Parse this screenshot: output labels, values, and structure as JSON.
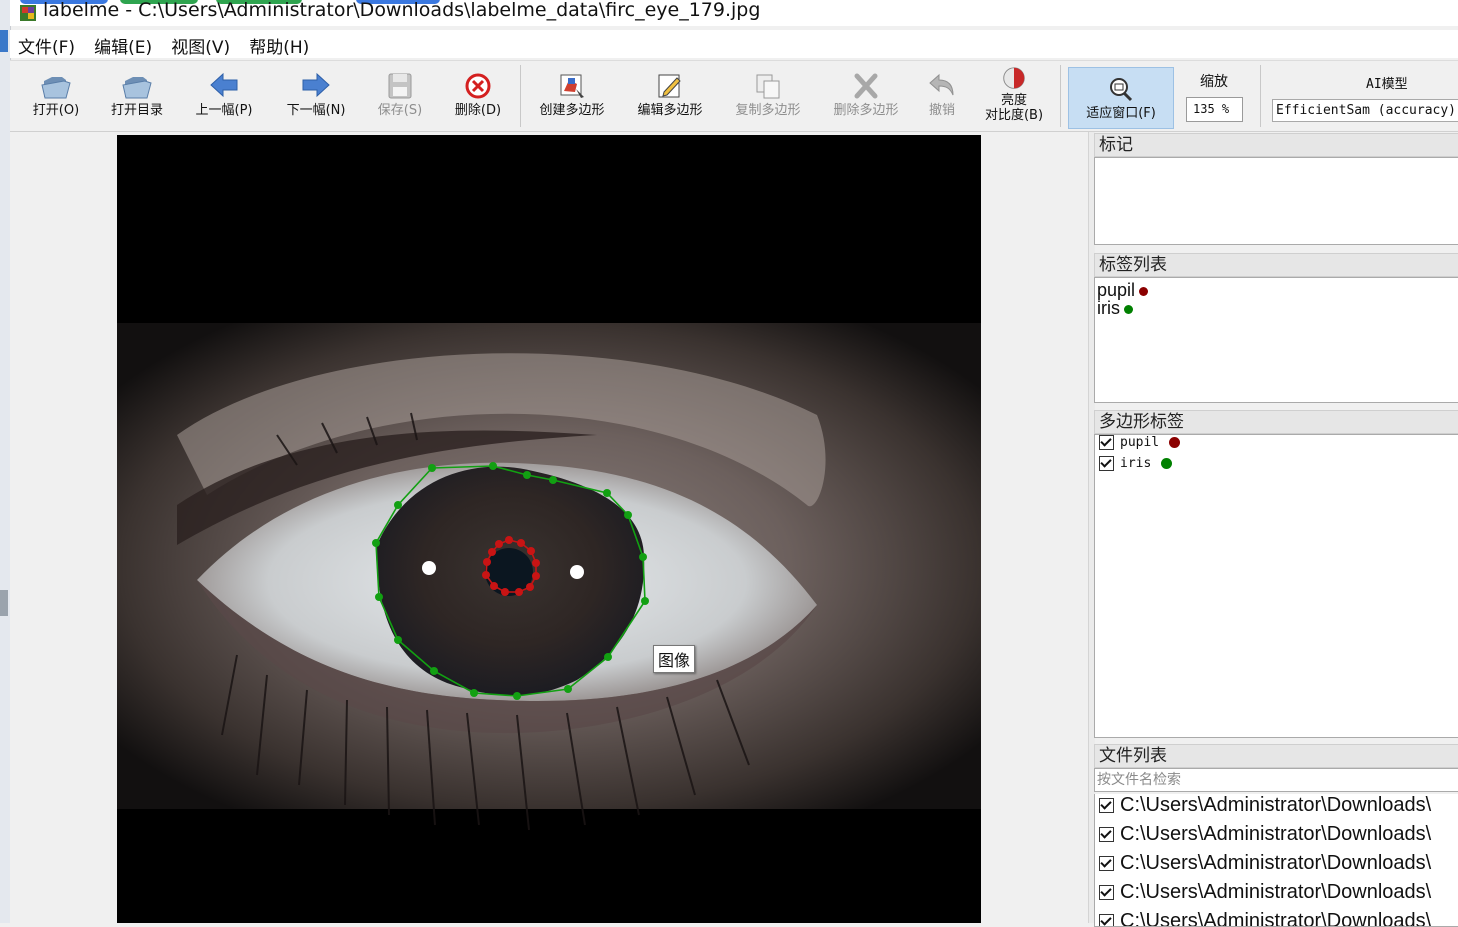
{
  "window": {
    "title": "labelme - C:\\Users\\Administrator\\Downloads\\labelme_data\\firc_eye_179.jpg"
  },
  "menu": [
    "文件(F)",
    "编辑(E)",
    "视图(V)",
    "帮助(H)"
  ],
  "toolbar": {
    "open": "打开(O)",
    "open_dir": "打开目录",
    "prev": "上一幅(P)",
    "next": "下一幅(N)",
    "save": "保存(S)",
    "delete": "删除(D)",
    "create_polygon": "创建多边形",
    "edit_polygon": "编辑多边形",
    "copy_polygon": "复制多边形",
    "delete_polygon": "删除多边形",
    "undo": "撤销",
    "brightness_line1": "亮度",
    "brightness_line2": "对比度(B)",
    "fit_window": "适应窗口(F)",
    "zoom_label": "缩放",
    "zoom_value": "135 %",
    "ai_label": "AI模型",
    "ai_model": "EfficientSam (accuracy)"
  },
  "canvas": {
    "tooltip": "图像"
  },
  "docks": {
    "flags_title": "标记",
    "label_list_title": "标签列表",
    "label_list": [
      {
        "name": "pupil",
        "color": "#8b0000"
      },
      {
        "name": "iris",
        "color": "#008000"
      }
    ],
    "polygon_labels_title": "多边形标签",
    "polygon_labels": [
      {
        "name": "pupil",
        "color": "#8b0000",
        "checked": true
      },
      {
        "name": "iris",
        "color": "#008000",
        "checked": true
      }
    ],
    "file_list_title": "文件列表",
    "file_search_placeholder": "按文件名检索",
    "files": [
      "C:\\Users\\Administrator\\Downloads\\",
      "C:\\Users\\Administrator\\Downloads\\",
      "C:\\Users\\Administrator\\Downloads\\",
      "C:\\Users\\Administrator\\Downloads\\",
      "C:\\Users\\Administrator\\Downloads\\"
    ]
  },
  "annotation_colors": {
    "iris": "#12a012",
    "pupil": "#c81414"
  }
}
